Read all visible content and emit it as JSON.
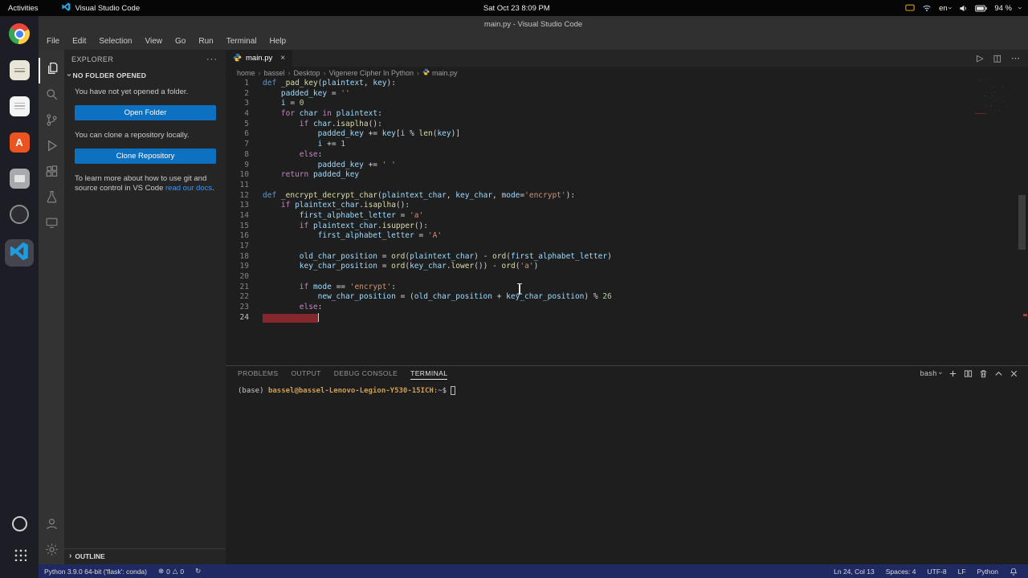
{
  "colors": {
    "accent_blue": "#0e70c1",
    "status_bar_background": "#1f2a63",
    "error_line_highlight": "#84282d",
    "terminal_prompt_color": "#cf9e52",
    "link_color": "#3794ff"
  },
  "top_bar": {
    "activities_label": "Activities",
    "focused_app_label": "Visual Studio Code",
    "clock": "Sat Oct 23  8:09 PM",
    "keyboard_layout": "en",
    "battery_percent": "94 %"
  },
  "dock": {
    "icons": [
      "chrome",
      "files",
      "text-editor",
      "ubuntu-software",
      "grey-app",
      "dark-circle-app",
      "vscode",
      "round-app",
      "show-applications"
    ]
  },
  "window": {
    "title": "main.py - Visual Studio Code"
  },
  "menu_bar": {
    "items": [
      "File",
      "Edit",
      "Selection",
      "View",
      "Go",
      "Run",
      "Terminal",
      "Help"
    ]
  },
  "activity_bar": {
    "icons": [
      "explorer",
      "search",
      "source-control",
      "run-and-debug",
      "extensions",
      "testing",
      "remote-explorer",
      "account",
      "settings-gear"
    ]
  },
  "sidebar": {
    "title": "EXPLORER",
    "more_actions": "···",
    "section_title": "NO FOLDER OPENED",
    "empty_text": "You have not yet opened a folder.",
    "open_folder_button": "Open Folder",
    "clone_text": "You can clone a repository locally.",
    "clone_button": "Clone Repository",
    "docs_text_before": "To learn more about how to use git and source control in VS Code ",
    "docs_link": "read our docs",
    "docs_text_after": ".",
    "outline_title": "OUTLINE"
  },
  "editor": {
    "tab_label": "main.py",
    "tab_close": "×",
    "run_glyph": "▷",
    "split_glyph": "◫",
    "more_glyph": "⋯",
    "breadcrumbs": [
      "home",
      "bassel",
      "Desktop",
      "Vigenere Cipher In Python",
      "main.py"
    ],
    "cursor": {
      "line": 24,
      "col": 13
    },
    "lines": [
      [
        [
          "k",
          "def"
        ],
        [
          "p",
          " "
        ],
        [
          "f",
          "_pad_key"
        ],
        [
          "p",
          "("
        ],
        [
          "v",
          "plaintext"
        ],
        [
          "p",
          ", "
        ],
        [
          "v",
          "key"
        ],
        [
          "p",
          "):"
        ]
      ],
      [
        [
          "p",
          "    "
        ],
        [
          "v",
          "padded_key"
        ],
        [
          "p",
          " = "
        ],
        [
          "s",
          "''"
        ]
      ],
      [
        [
          "p",
          "    "
        ],
        [
          "v",
          "i"
        ],
        [
          "p",
          " = "
        ],
        [
          "n",
          "0"
        ]
      ],
      [
        [
          "p",
          "    "
        ],
        [
          "c",
          "for"
        ],
        [
          "p",
          " "
        ],
        [
          "v",
          "char"
        ],
        [
          "p",
          " "
        ],
        [
          "c",
          "in"
        ],
        [
          "p",
          " "
        ],
        [
          "v",
          "plaintext"
        ],
        [
          "p",
          ":"
        ]
      ],
      [
        [
          "p",
          "        "
        ],
        [
          "c",
          "if"
        ],
        [
          "p",
          " "
        ],
        [
          "v",
          "char"
        ],
        [
          "p",
          "."
        ],
        [
          "f",
          "isaplha"
        ],
        [
          "p",
          "():"
        ]
      ],
      [
        [
          "p",
          "            "
        ],
        [
          "v",
          "padded_key"
        ],
        [
          "p",
          " += "
        ],
        [
          "v",
          "key"
        ],
        [
          "p",
          "["
        ],
        [
          "v",
          "i"
        ],
        [
          "p",
          " % "
        ],
        [
          "f",
          "len"
        ],
        [
          "p",
          "("
        ],
        [
          "v",
          "key"
        ],
        [
          "p",
          ")]"
        ]
      ],
      [
        [
          "p",
          "            "
        ],
        [
          "v",
          "i"
        ],
        [
          "p",
          " += "
        ],
        [
          "n",
          "1"
        ]
      ],
      [
        [
          "p",
          "        "
        ],
        [
          "c",
          "else"
        ],
        [
          "p",
          ":"
        ]
      ],
      [
        [
          "p",
          "            "
        ],
        [
          "v",
          "padded_key"
        ],
        [
          "p",
          " += "
        ],
        [
          "s",
          "' '"
        ]
      ],
      [
        [
          "p",
          "    "
        ],
        [
          "c",
          "return"
        ],
        [
          "p",
          " "
        ],
        [
          "v",
          "padded_key"
        ]
      ],
      [],
      [
        [
          "k",
          "def"
        ],
        [
          "p",
          " "
        ],
        [
          "f",
          "_encrypt_decrypt_char"
        ],
        [
          "p",
          "("
        ],
        [
          "v",
          "plaintext_char"
        ],
        [
          "p",
          ", "
        ],
        [
          "v",
          "key_char"
        ],
        [
          "p",
          ", "
        ],
        [
          "v",
          "mode"
        ],
        [
          "p",
          "="
        ],
        [
          "s",
          "'encrypt'"
        ],
        [
          "p",
          "):"
        ]
      ],
      [
        [
          "p",
          "    "
        ],
        [
          "c",
          "if"
        ],
        [
          "p",
          " "
        ],
        [
          "v",
          "plaintext_char"
        ],
        [
          "p",
          "."
        ],
        [
          "f",
          "isaplha"
        ],
        [
          "p",
          "():"
        ]
      ],
      [
        [
          "p",
          "        "
        ],
        [
          "v",
          "first_alphabet_letter"
        ],
        [
          "p",
          " = "
        ],
        [
          "s",
          "'a'"
        ]
      ],
      [
        [
          "p",
          "        "
        ],
        [
          "c",
          "if"
        ],
        [
          "p",
          " "
        ],
        [
          "v",
          "plaintext_char"
        ],
        [
          "p",
          "."
        ],
        [
          "f",
          "isupper"
        ],
        [
          "p",
          "():"
        ]
      ],
      [
        [
          "p",
          "            "
        ],
        [
          "v",
          "first_alphabet_letter"
        ],
        [
          "p",
          " = "
        ],
        [
          "s",
          "'A'"
        ]
      ],
      [],
      [
        [
          "p",
          "        "
        ],
        [
          "v",
          "old_char_position"
        ],
        [
          "p",
          " = "
        ],
        [
          "f",
          "ord"
        ],
        [
          "p",
          "("
        ],
        [
          "v",
          "plaintext_char"
        ],
        [
          "p",
          ") - "
        ],
        [
          "f",
          "ord"
        ],
        [
          "p",
          "("
        ],
        [
          "v",
          "first_alphabet_letter"
        ],
        [
          "p",
          ")"
        ]
      ],
      [
        [
          "p",
          "        "
        ],
        [
          "v",
          "key_char_position"
        ],
        [
          "p",
          " = "
        ],
        [
          "f",
          "ord"
        ],
        [
          "p",
          "("
        ],
        [
          "v",
          "key_char"
        ],
        [
          "p",
          "."
        ],
        [
          "f",
          "lower"
        ],
        [
          "p",
          "()) - "
        ],
        [
          "f",
          "ord"
        ],
        [
          "p",
          "("
        ],
        [
          "s",
          "'a'"
        ],
        [
          "p",
          ")"
        ]
      ],
      [],
      [
        [
          "p",
          "        "
        ],
        [
          "c",
          "if"
        ],
        [
          "p",
          " "
        ],
        [
          "v",
          "mode"
        ],
        [
          "p",
          " == "
        ],
        [
          "s",
          "'encrypt'"
        ],
        [
          "p",
          ":"
        ]
      ],
      [
        [
          "p",
          "            "
        ],
        [
          "v",
          "new_char_position"
        ],
        [
          "p",
          " = ("
        ],
        [
          "v",
          "old_char_position"
        ],
        [
          "p",
          " + "
        ],
        [
          "v",
          "key_char_position"
        ],
        [
          "p",
          ") % "
        ],
        [
          "n",
          "26"
        ]
      ],
      [
        [
          "p",
          "        "
        ],
        [
          "c",
          "else"
        ],
        [
          "p",
          ":"
        ]
      ],
      [
        [
          "r",
          "            "
        ]
      ]
    ]
  },
  "panel": {
    "tabs": [
      "PROBLEMS",
      "OUTPUT",
      "DEBUG CONSOLE",
      "TERMINAL"
    ],
    "active_tab": "TERMINAL",
    "shell_label": "bash",
    "terminal": {
      "env_prefix": "(base) ",
      "user_host": "bassel@bassel-Lenovo-Legion-Y530-15ICH",
      "path_suffix": ":~$"
    }
  },
  "status_bar": {
    "interpreter": "Python 3.9.0 64-bit ('flask': conda)",
    "error_glyph": "⊗",
    "error_count": "0",
    "warning_glyph": "△",
    "warning_count": "0",
    "sync_glyph": "↻",
    "line_col": "Ln 24, Col 13",
    "indentation": "Spaces: 4",
    "encoding": "UTF-8",
    "eol": "LF",
    "language_mode": "Python"
  }
}
